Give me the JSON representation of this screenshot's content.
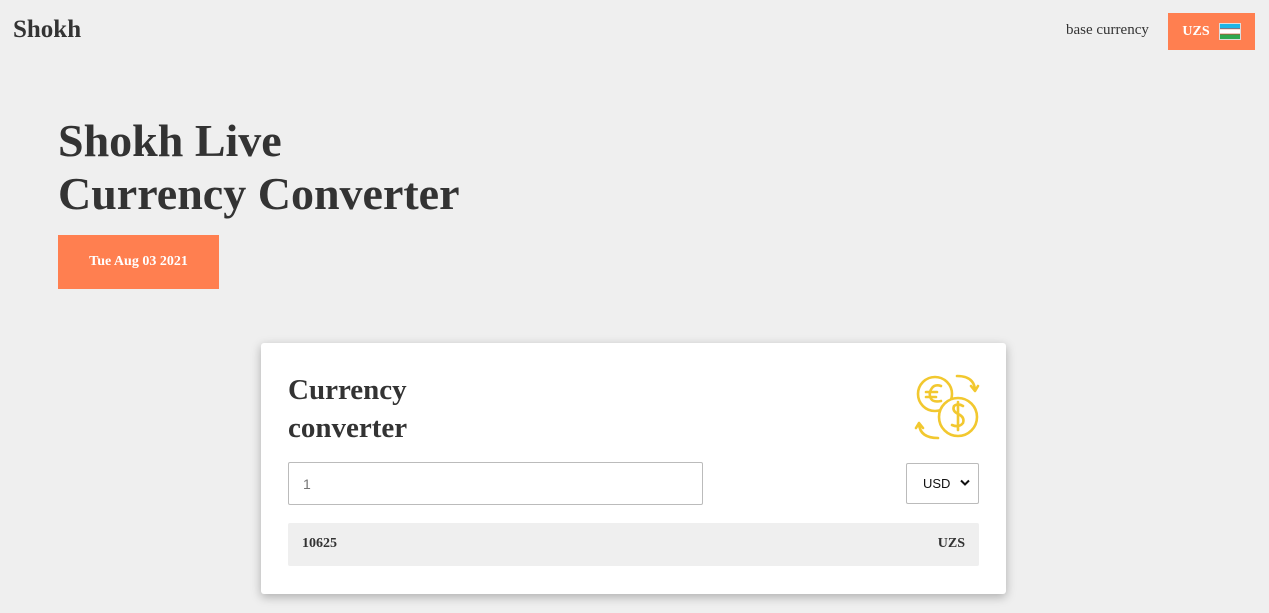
{
  "header": {
    "logo": "Shokh",
    "base_label": "base currency",
    "base_button": {
      "label": "UZS",
      "flag_icon": "uzbekistan-flag-icon"
    }
  },
  "hero": {
    "title_line1": "Shokh Live",
    "title_line2": "Currency Converter",
    "date": "Tue Aug 03 2021"
  },
  "converter": {
    "title_line1": "Currency",
    "title_line2": "converter",
    "icon": "currency-exchange-icon",
    "amount_placeholder": "1",
    "amount_value": "",
    "currency_selected": "USD",
    "result_value": "10625",
    "result_currency": "UZS"
  },
  "colors": {
    "accent": "#ff7f50",
    "background": "#efefef",
    "icon": "#f2c82f",
    "text": "#333333"
  }
}
